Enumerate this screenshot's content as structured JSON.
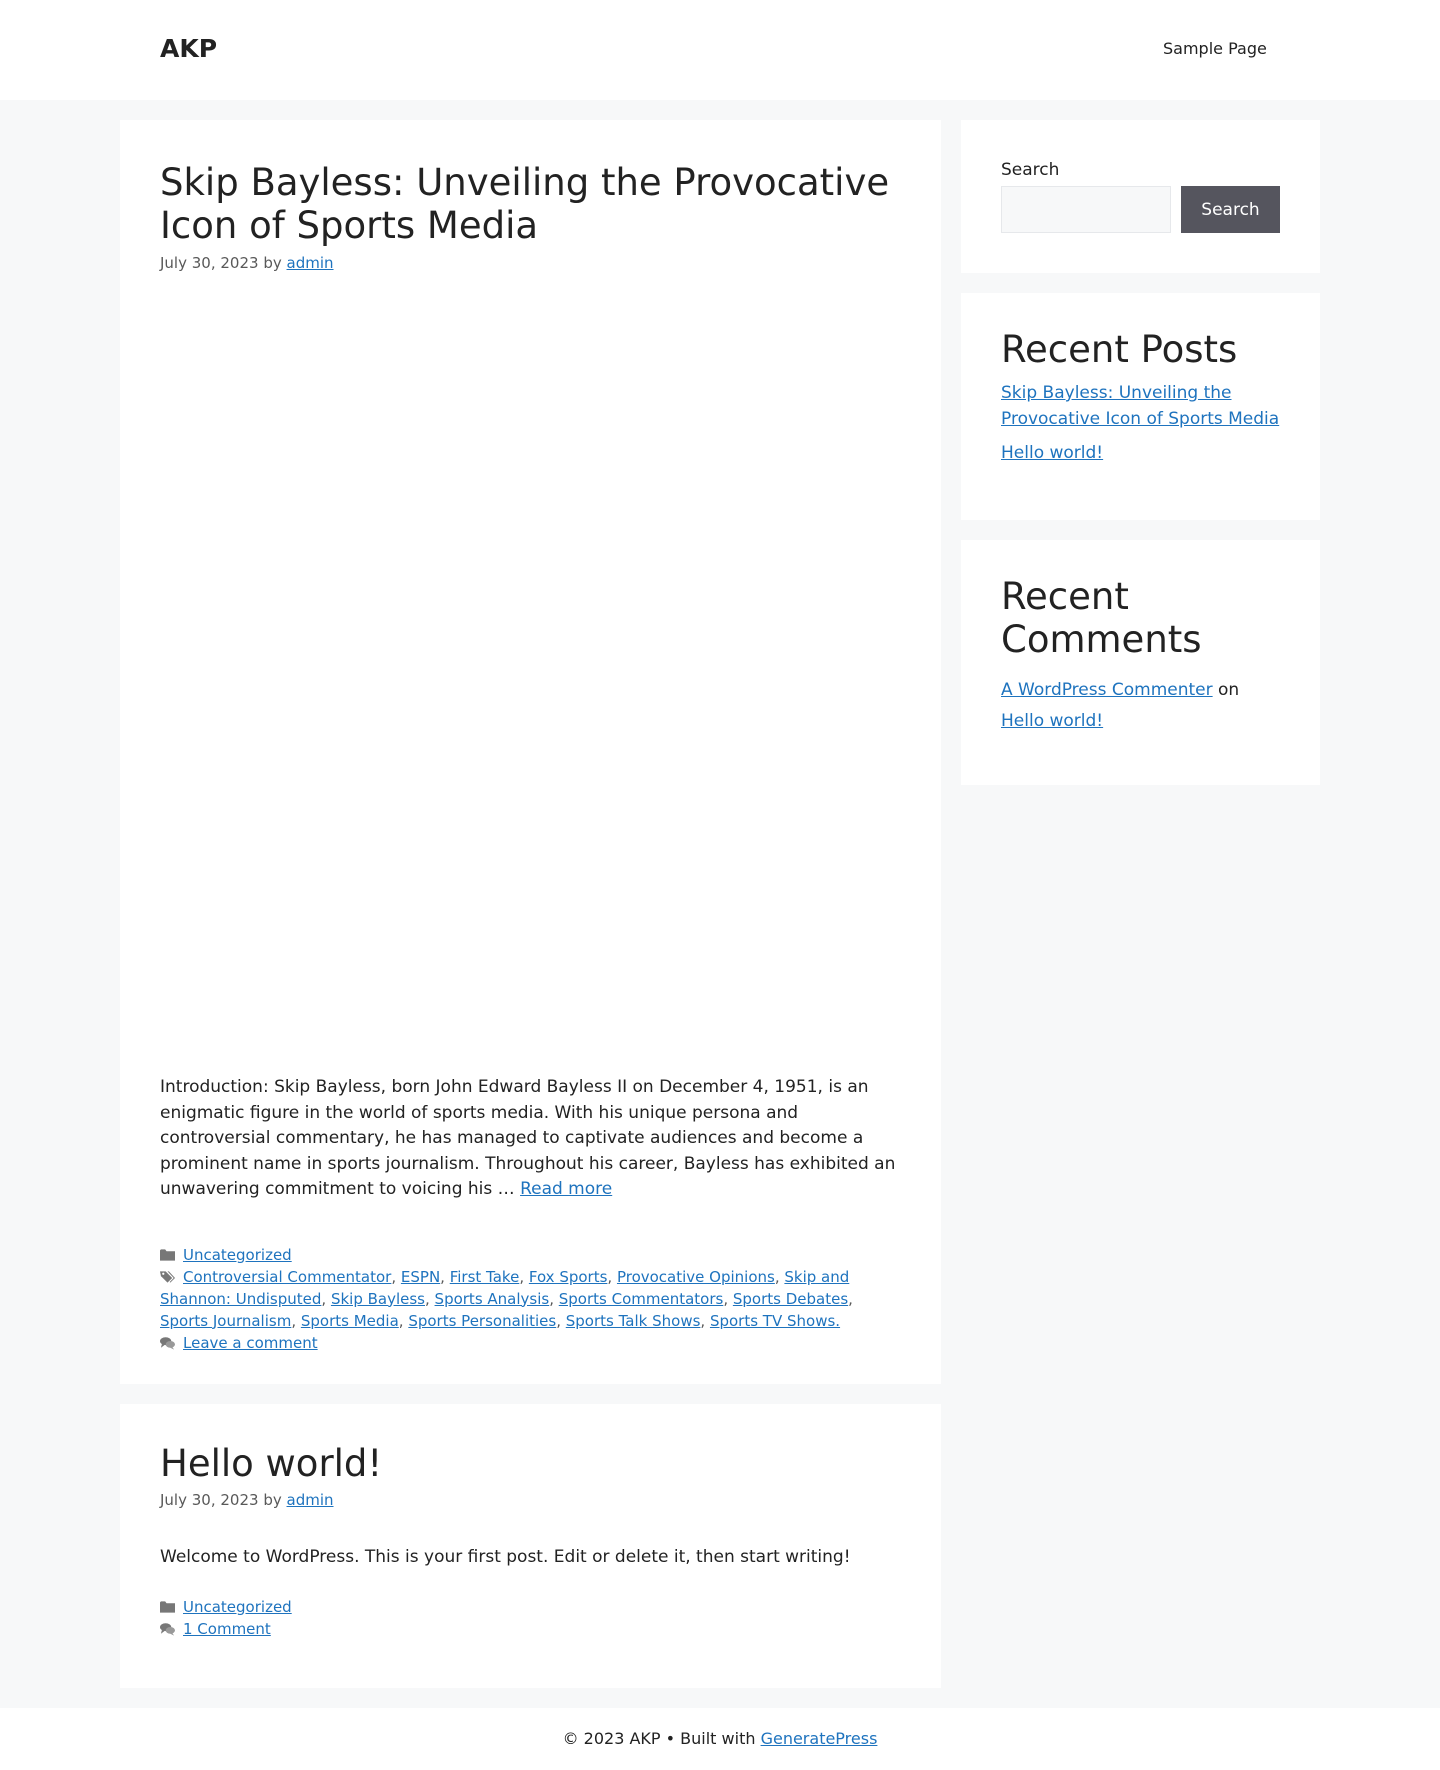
{
  "header": {
    "site_title": "AKP",
    "nav": [
      "Sample Page"
    ]
  },
  "posts": [
    {
      "title": "Skip Bayless: Unveiling the Provocative Icon of Sports Media",
      "date": "July 30, 2023",
      "by": "by",
      "author": "admin",
      "summary": "Introduction: Skip Bayless, born John Edward Bayless II on December 4, 1951, is an enigmatic figure in the world of sports media. With his unique persona and controversial commentary, he has managed to captivate audiences and become a prominent name in sports journalism. Throughout his career, Bayless has exhibited an unwavering commitment to voicing his …",
      "read_more": "Read more",
      "category": "Uncategorized",
      "tags": [
        "Controversial Commentator",
        "ESPN",
        "First Take",
        "Fox Sports",
        "Provocative Opinions",
        "Skip and Shannon: Undisputed",
        "Skip Bayless",
        "Sports Analysis",
        "Sports Commentators",
        "Sports Debates",
        "Sports Journalism",
        "Sports Media",
        "Sports Personalities",
        "Sports Talk Shows",
        "Sports TV Shows."
      ],
      "comments_link": "Leave a comment"
    },
    {
      "title": "Hello world!",
      "date": "July 30, 2023",
      "by": "by",
      "author": "admin",
      "summary": "Welcome to WordPress. This is your first post. Edit or delete it, then start writing!",
      "category": "Uncategorized",
      "comments_link": "1 Comment"
    }
  ],
  "sidebar": {
    "search": {
      "label": "Search",
      "button": "Search"
    },
    "recent_posts": {
      "title": "Recent Posts",
      "items": [
        "Skip Bayless: Unveiling the Provocative Icon of Sports Media",
        "Hello world!"
      ]
    },
    "recent_comments": {
      "title": "Recent Comments",
      "commenter": "A WordPress Commenter",
      "on": "on",
      "post": "Hello world!"
    }
  },
  "footer": {
    "copyright": "© 2023 AKP • Built with",
    "link": "GeneratePress"
  }
}
